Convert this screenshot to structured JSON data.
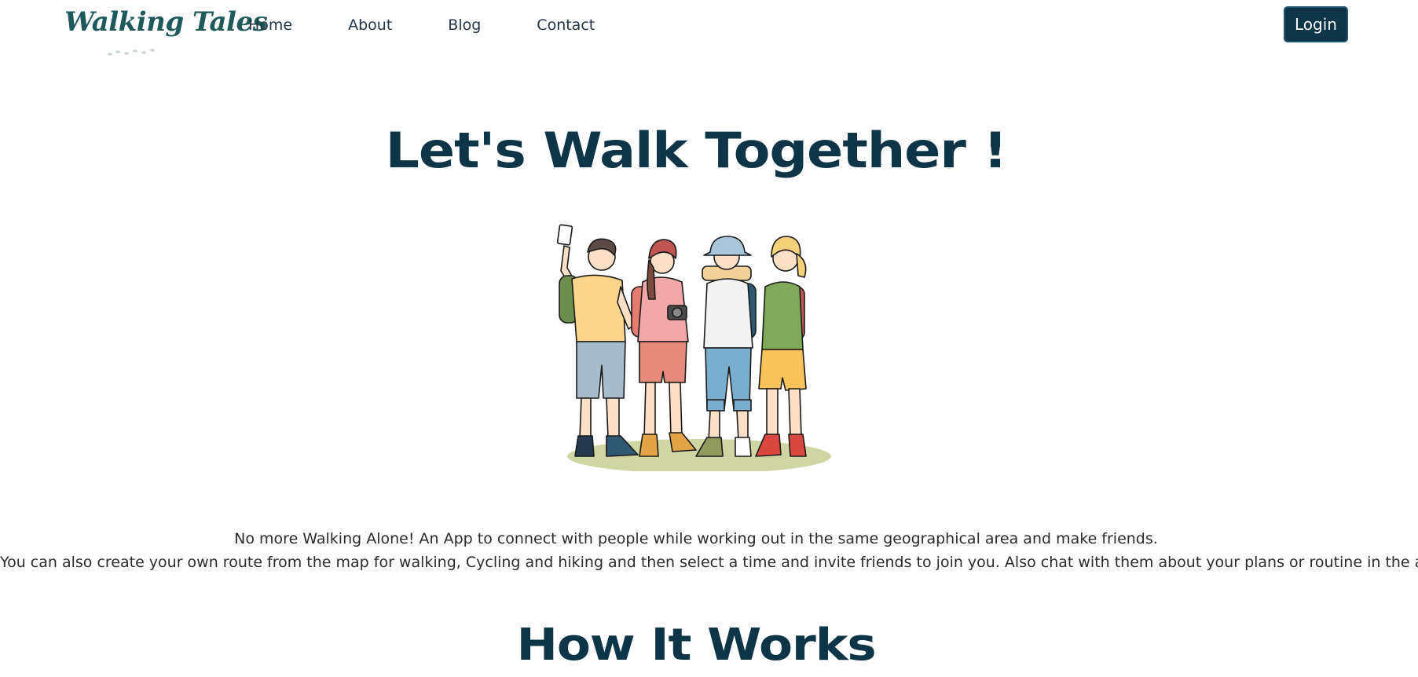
{
  "logo": {
    "text": "Walking Tales",
    "color": "#1e5a5c"
  },
  "nav": {
    "links": [
      {
        "label": "Home"
      },
      {
        "label": "About"
      },
      {
        "label": "Blog"
      },
      {
        "label": "Contact"
      }
    ],
    "login_label": "Login"
  },
  "hero": {
    "title": "Let's Walk Together !",
    "illustration": "group-of-four-hikers-illustration",
    "description_line_1": "No more Walking Alone! An App to connect with people while working out in the same geographical area and make friends.",
    "description_line_2": "You can also create your own route from the map for walking, Cycling and hiking and then select a time and invite friends to join you. Also chat with them about your plans or routine in the app itself."
  },
  "how_it_works": {
    "title": "How It Works"
  },
  "colors": {
    "primary": "#0d3447",
    "accent": "#1e5a5c",
    "background": "#ffffff"
  }
}
